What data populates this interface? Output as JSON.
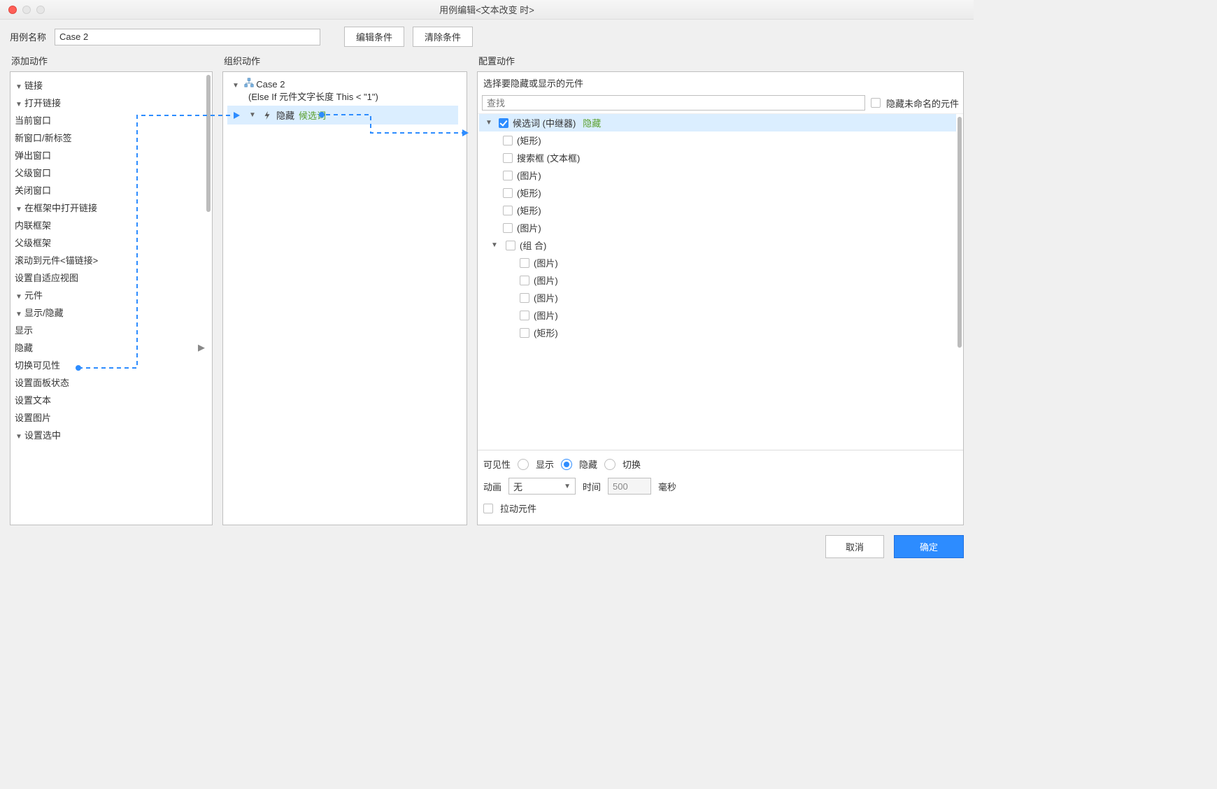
{
  "window": {
    "title": "用例编辑<文本改变 时>"
  },
  "top": {
    "case_name_label": "用例名称",
    "case_name_value": "Case 2",
    "edit_cond": "编辑条件",
    "clear_cond": "清除条件"
  },
  "left": {
    "title": "添加动作",
    "tree": {
      "links": "链接",
      "open_link": "打开链接",
      "current_window": "当前窗口",
      "new_window": "新窗口/新标签",
      "popup": "弹出窗口",
      "parent_window": "父级窗口",
      "close_window": "关闭窗口",
      "open_in_frame": "在框架中打开链接",
      "inline_frame": "内联框架",
      "parent_frame": "父级框架",
      "scroll_anchor": "滚动到元件<锚链接>",
      "set_adaptive": "设置自适应视图",
      "widgets": "元件",
      "show_hide": "显示/隐藏",
      "show": "显示",
      "hide": "隐藏",
      "toggle_vis": "切换可见性",
      "set_panel": "设置面板状态",
      "set_text": "设置文本",
      "set_image": "设置图片",
      "set_selected": "设置选中"
    }
  },
  "mid": {
    "title": "组织动作",
    "case_label": "Case 2",
    "condition": "(Else If 元件文字长度 This < \"1\")",
    "action_hide": "隐藏",
    "action_target": "候选词"
  },
  "right": {
    "title": "配置动作",
    "header": "选择要隐藏或显示的元件",
    "search_placeholder": "查找",
    "hide_unnamed": "隐藏未命名的元件",
    "items": {
      "candidate": "候选词 (中继器)",
      "candidate_status": "隐藏",
      "rect1": "(矩形)",
      "searchbox": "搜索框 (文本框)",
      "img1": "(图片)",
      "rect2": "(矩形)",
      "rect3": "(矩形)",
      "img2": "(图片)",
      "group": "(组 合)",
      "g_img1": "(图片)",
      "g_img2": "(图片)",
      "g_img3": "(图片)",
      "g_img4": "(图片)",
      "g_rect": "(矩形)"
    },
    "cfg": {
      "visibility_label": "可见性",
      "opt_show": "显示",
      "opt_hide": "隐藏",
      "opt_toggle": "切换",
      "anim_label": "动画",
      "anim_value": "无",
      "time_label": "时间",
      "time_value": "500",
      "time_unit": "毫秒",
      "pull_label": "拉动元件"
    }
  },
  "footer": {
    "cancel": "取消",
    "ok": "确定"
  }
}
